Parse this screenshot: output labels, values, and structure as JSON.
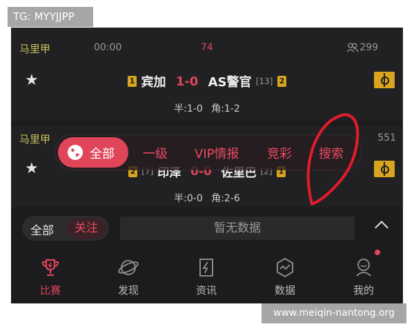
{
  "watermark_top": "TG: MYYJJPP",
  "watermark_bottom": "www.meiqin-nantong.org",
  "match1": {
    "league": "马里甲",
    "time": "00:00",
    "minute": "74",
    "watchers": "299",
    "home_rank": "1",
    "home": "宾加",
    "score": "1-0",
    "away": "AS警官",
    "away_league_rank": "[13]",
    "away_rank": "2",
    "halftime": "半:1-0",
    "corners": "角:1-2"
  },
  "match2": {
    "league": "马里甲",
    "watchers_partial": "551",
    "home_rank": "2",
    "home_league_rank": "[7]",
    "home_partial": "印泽",
    "score_partial": "0-0",
    "away_partial": "佐里巴",
    "away_league_rank": "[2]",
    "away_rank": "1",
    "halftime": "半:0-0",
    "corners": "角:2-6"
  },
  "filter_tabs": {
    "all": "全部",
    "level1": "一级",
    "vip": "VIP情报",
    "lottery": "竞彩",
    "search": "搜索"
  },
  "segment": {
    "all": "全部",
    "follow": "关注"
  },
  "no_data": "暂无数据",
  "nav": [
    {
      "label": "比赛",
      "icon": "trophy-icon"
    },
    {
      "label": "发现",
      "icon": "planet-icon"
    },
    {
      "label": "资讯",
      "icon": "lightning-doc-icon"
    },
    {
      "label": "数据",
      "icon": "pulse-hexagon-icon"
    },
    {
      "label": "我的",
      "icon": "profile-icon"
    }
  ],
  "colors": {
    "accent": "#e0455a",
    "league": "#c8c05a",
    "badge": "#d9a41e",
    "background": "#1c1c1e"
  }
}
